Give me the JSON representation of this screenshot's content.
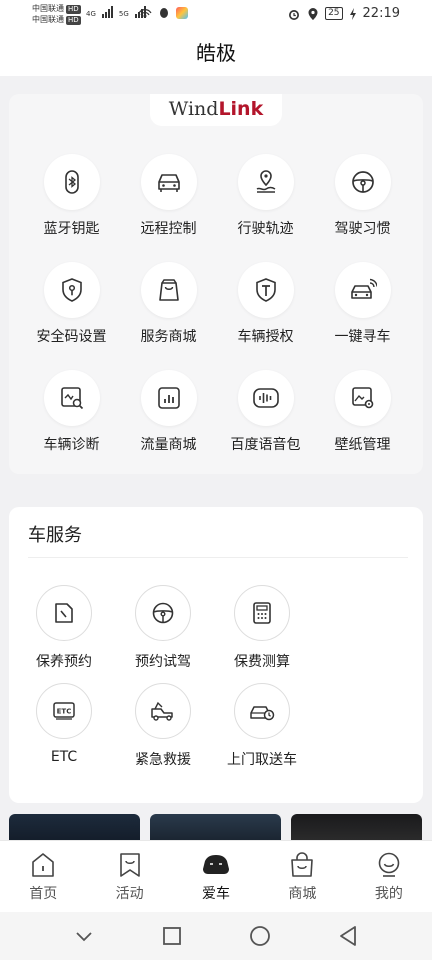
{
  "status_bar": {
    "carrier_1": "中国联通",
    "carrier_2": "中国联通",
    "hd_badge": "HD",
    "net_1": "4G",
    "net_2": "5G",
    "battery": "25",
    "time": "22:19"
  },
  "header": {
    "title": "皓极"
  },
  "feature_card": {
    "brand_part1": "Wind",
    "brand_part2": "Link",
    "items": [
      {
        "label": "蓝牙钥匙",
        "icon": "bluetooth-key-icon"
      },
      {
        "label": "远程控制",
        "icon": "car-front-icon"
      },
      {
        "label": "行驶轨迹",
        "icon": "route-pin-icon"
      },
      {
        "label": "驾驶习惯",
        "icon": "steering-wheel-icon"
      },
      {
        "label": "安全码设置",
        "icon": "shield-lock-icon"
      },
      {
        "label": "服务商城",
        "icon": "shopping-bag-icon"
      },
      {
        "label": "车辆授权",
        "icon": "authorization-shield-icon"
      },
      {
        "label": "一键寻车",
        "icon": "find-car-icon"
      },
      {
        "label": "车辆诊断",
        "icon": "diagnosis-icon"
      },
      {
        "label": "流量商城",
        "icon": "data-chart-icon"
      },
      {
        "label": "百度语音包",
        "icon": "voice-wave-icon"
      },
      {
        "label": "壁纸管理",
        "icon": "wallpaper-settings-icon"
      }
    ]
  },
  "car_service": {
    "title": "车服务",
    "items": [
      {
        "label": "保养预约",
        "icon": "maintenance-icon"
      },
      {
        "label": "预约试驾",
        "icon": "steering-wheel-icon"
      },
      {
        "label": "保费测算",
        "icon": "calculator-icon"
      },
      {
        "label": "ETC",
        "icon": "etc-icon"
      },
      {
        "label": "紧急救援",
        "icon": "tow-truck-icon"
      },
      {
        "label": "上门取送车",
        "icon": "car-pickup-icon"
      }
    ]
  },
  "tab_bar": {
    "tabs": [
      {
        "label": "首页",
        "icon": "home-icon"
      },
      {
        "label": "活动",
        "icon": "activity-bookmark-icon"
      },
      {
        "label": "爱车",
        "icon": "my-car-icon"
      },
      {
        "label": "商城",
        "icon": "shop-bag-icon"
      },
      {
        "label": "我的",
        "icon": "profile-icon"
      }
    ],
    "active": "爱车"
  },
  "colors": {
    "brand_red": "#b3152b",
    "page_bg": "#f1f1f3",
    "card_bg": "#f6f6f7"
  }
}
